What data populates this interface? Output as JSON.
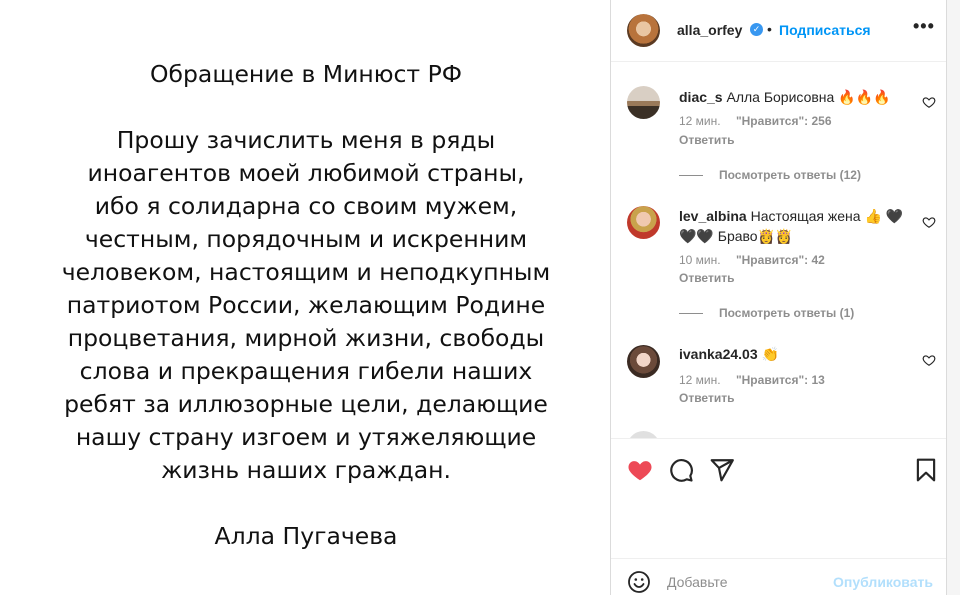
{
  "post": {
    "title": "Обращение в Минюст РФ",
    "body_lines": [
      "Прошу зачислить меня в ряды",
      "иноагентов моей любимой страны,",
      "ибо я солидарна со своим мужем,",
      "честным, порядочным и искренним",
      "человеком, настоящим и неподкупным",
      "патриотом России, желающим Родине",
      "процветания, мирной жизни, свободы",
      "слова и прекращения гибели наших",
      "ребят за иллюзорные цели, делающие",
      "нашу страну изгоем и утяжеляющие",
      "жизнь наших граждан."
    ],
    "signature": "Алла Пугачева"
  },
  "header": {
    "username": "alla_orfey",
    "verified_icon": "verified-badge-icon",
    "separator": "•",
    "follow_label": "Подписаться",
    "more_label": "•••"
  },
  "comments": [
    {
      "username": "diac_s",
      "text": "Алла Борисовна 🔥🔥🔥",
      "time": "12 мин.",
      "likes": "\"Нравится\": 256",
      "reply": "Ответить",
      "view_replies": "Посмотреть ответы (12)"
    },
    {
      "username": "lev_albina",
      "text": "Настоящая жена 👍 🖤🖤🖤 Браво👸👸",
      "time": "10 мин.",
      "likes": "\"Нравится\": 42",
      "reply": "Ответить",
      "view_replies": "Посмотреть ответы (1)"
    },
    {
      "username": "ivanka24.03",
      "text": "👏",
      "time": "12 мин.",
      "likes": "\"Нравится\": 13",
      "reply": "Ответить"
    }
  ],
  "actions": {
    "like_icon": "heart-filled-icon",
    "comment_icon": "comment-icon",
    "share_icon": "send-icon",
    "save_icon": "bookmark-icon"
  },
  "add_comment": {
    "placeholder": "Добавьте",
    "publish_label": "Опубликовать"
  },
  "colors": {
    "accent": "#0095f6",
    "like_red": "#ed4956",
    "muted": "#8e8e8e",
    "publish_disabled": "#b2dffc"
  }
}
